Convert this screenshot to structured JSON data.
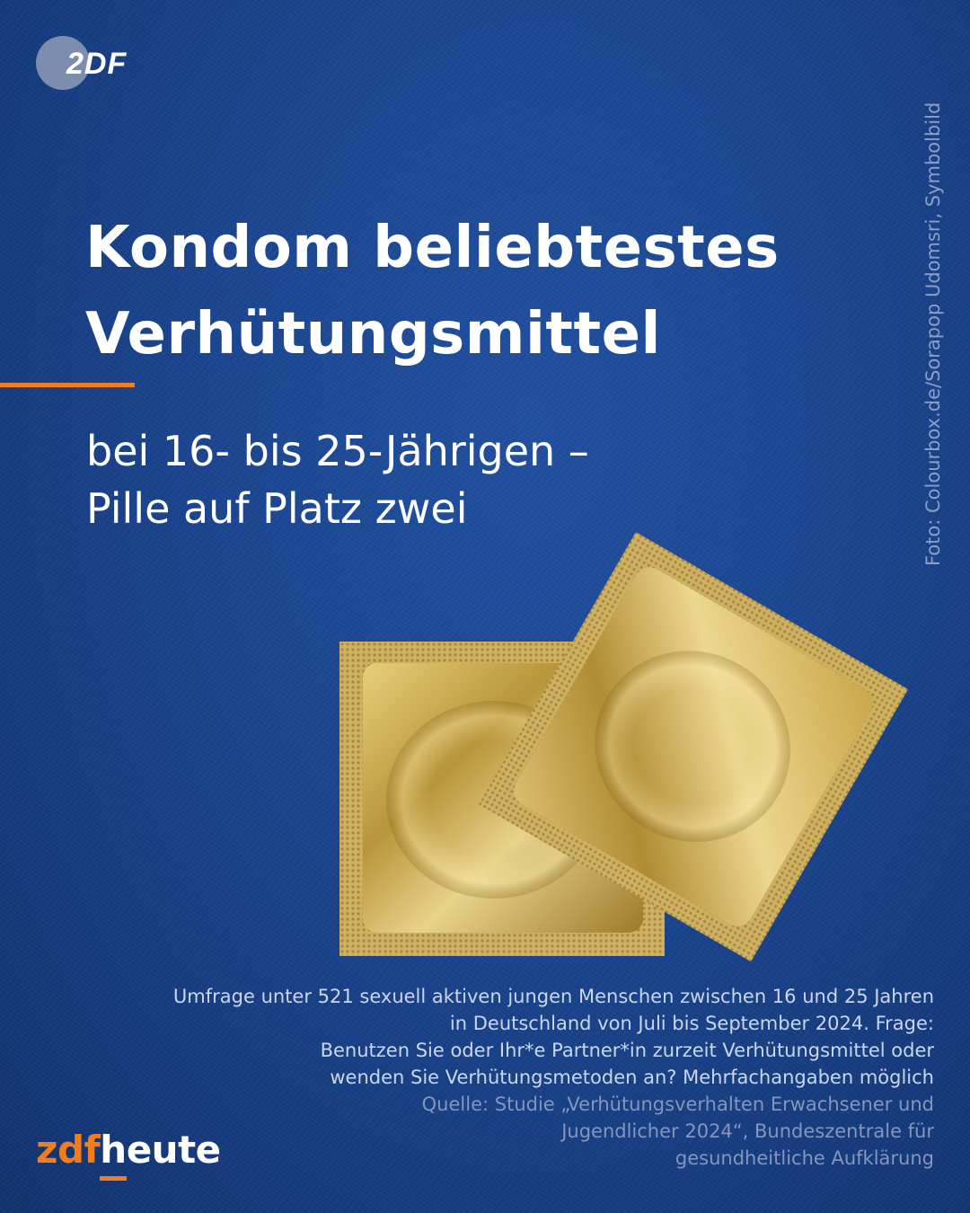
{
  "logo": {
    "text": "2DF"
  },
  "headline": {
    "line1": "Kondom beliebtestes",
    "line2": "Verhütungsmittel"
  },
  "subline": {
    "line1": "bei 16- bis 25-Jährigen –",
    "line2": "Pille auf Platz zwei"
  },
  "credit": "Foto: Colourbox.de/Sorapop Udomsri, Symbolbild",
  "caption": {
    "line1": "Umfrage unter 521 sexuell aktiven jungen Menschen zwischen 16 und 25 Jahren",
    "line2": "in Deutschland von Juli bis September 2024. Frage:",
    "line3": "Benutzen Sie oder Ihr*e Partner*in zurzeit Verhütungsmittel oder",
    "line4": "wenden Sie Verhütungsmetoden an? Mehrfachangaben möglich"
  },
  "source": {
    "line1": "Quelle: Studie „Verhütungsverhalten Erwachsener und",
    "line2": "Jugendlicher 2024“, Bundeszentrale für",
    "line3": "gesundheitliche Aufklärung"
  },
  "brand": {
    "zdf": "zdf",
    "heute": "heute"
  },
  "colors": {
    "background": "#1a4591",
    "accent": "#f07d1e",
    "text": "#ffffff",
    "muted": "#8d9ec4",
    "foil": "#c9a84a"
  },
  "icons": {
    "top_logo": "zdf-logo-icon",
    "photo": "condom-packets-photo"
  }
}
